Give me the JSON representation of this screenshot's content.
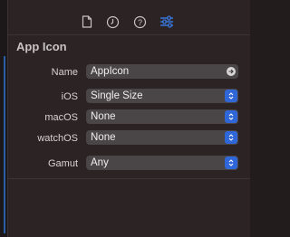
{
  "toolbar": {
    "tabs": [
      {
        "icon": "file-icon"
      },
      {
        "icon": "history-icon"
      },
      {
        "icon": "help-icon"
      },
      {
        "icon": "attributes-inspector-icon",
        "active": true
      }
    ],
    "active_color": "#3b82f6"
  },
  "section": {
    "title": "App Icon"
  },
  "fields": {
    "name": {
      "label": "Name",
      "value": "AppIcon"
    },
    "ios": {
      "label": "iOS",
      "value": "Single Size"
    },
    "macos": {
      "label": "macOS",
      "value": "None"
    },
    "watchos": {
      "label": "watchOS",
      "value": "None"
    },
    "gamut": {
      "label": "Gamut",
      "value": "Any"
    }
  },
  "colors": {
    "popup_button": "#2f66d8",
    "field_bg": "#4a4546"
  }
}
